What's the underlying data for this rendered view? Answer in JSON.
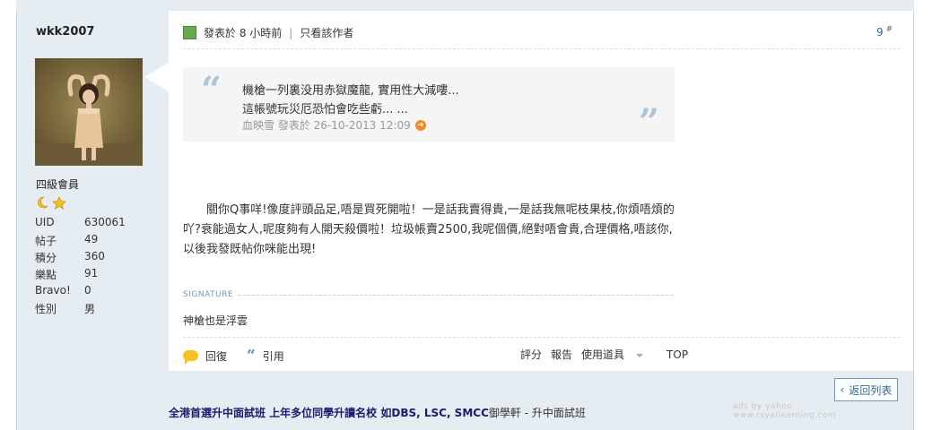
{
  "author": {
    "username": "wkk2007",
    "rank": "四級會員",
    "stats": [
      {
        "key": "UID",
        "value": "630061"
      },
      {
        "key": "帖子",
        "value": "49"
      },
      {
        "key": "積分",
        "value": "360"
      },
      {
        "key": "樂點",
        "value": "91"
      },
      {
        "key": "Bravo!",
        "value": "0"
      },
      {
        "key": "性別",
        "value": "男"
      }
    ]
  },
  "post": {
    "posted": "發表於 8 小時前",
    "only_author": "只看該作者",
    "floor": "9",
    "floor_mark": "#",
    "quote": {
      "line1": "機槍一列裏没用赤獄魔龍, 實用性大減嘍...",
      "line2": "這帳號玩災厄恐怕會吃些虧... ...",
      "meta": "血映雪 發表於 26-10-2013 12:09"
    },
    "body": "　　關你Q事咩!像度評頭品足,唔是買死開啦！一是話我賣得貴,一是話我無呢枝果枝,你煩唔煩的吖?᠍衰能過女人,呢度夠有人開天殺價啦！垃圾帳賣2500,我呢個價,絕對唔會貴,合理價格,唔該你,以後我發既帖你咪能出現!",
    "signature_label": "SIGNATURE",
    "signature": "神槍也是浮雲"
  },
  "actions": {
    "reply": "回復",
    "quote": "引用",
    "rate": "評分",
    "report": "報告",
    "tools": "使用道具",
    "top": "TOP"
  },
  "footer": {
    "back": "返回列表",
    "ad_main": "全港首選升中面試班 上年多位同學升讀名校 如DBS, LSC, SMCC",
    "ad_suffix": "御學軒 - 升中面試班",
    "ads_by": "ads by yahoo",
    "ads_site": "www.rsyallearning.com"
  },
  "colors": {
    "sidebar_bg": "#e5edf2",
    "link": "#336699",
    "quote_mark": "#a9c6de"
  }
}
